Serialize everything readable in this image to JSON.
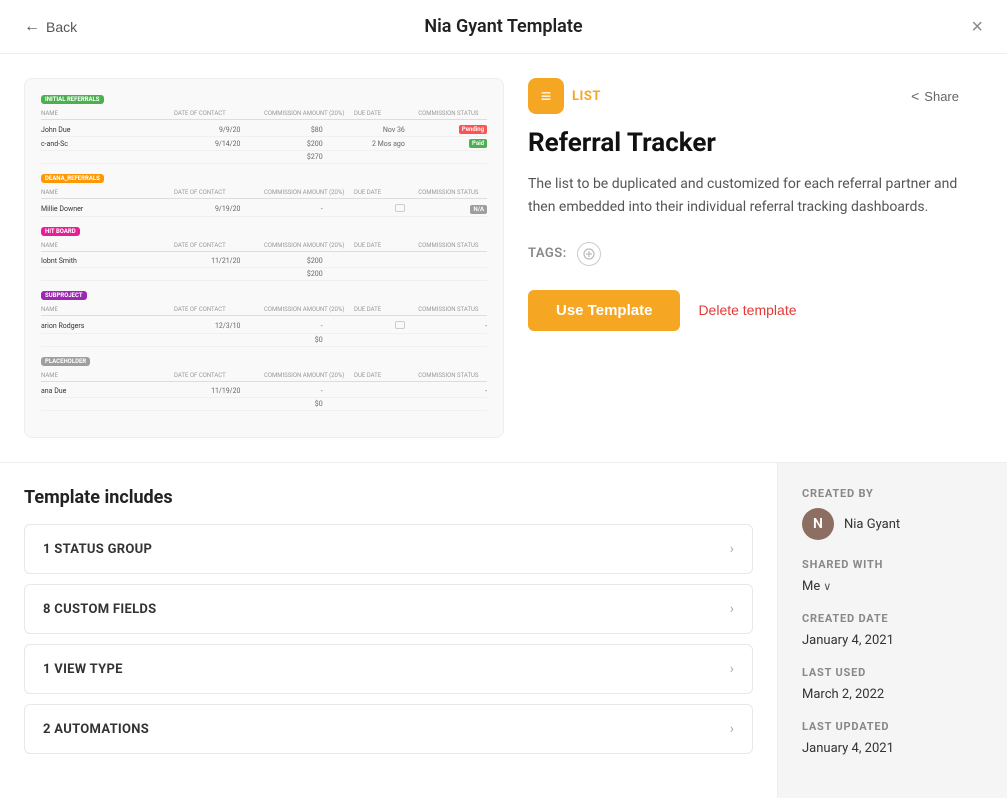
{
  "header": {
    "title": "Nia Gyant Template",
    "back_label": "Back",
    "close_label": "×"
  },
  "preview": {
    "sections": [
      {
        "badge_label": "INITIAL REFERRALS",
        "badge_color": "green",
        "rows": [
          {
            "name": "John Due",
            "date": "9/9/20",
            "commission": "$80",
            "due_date": "Nov 36",
            "status": "Pending",
            "status_color": "pending"
          },
          {
            "name": "c-and-Sc",
            "date": "9/14/20",
            "commission": "$200",
            "due_date": "2 More ago",
            "status": "Paid",
            "status_color": "paid"
          }
        ]
      },
      {
        "badge_label": "DEANA_REFERRALS",
        "badge_color": "orange",
        "rows": [
          {
            "name": "Millie Downer",
            "date": "9/19/20",
            "commission": "-",
            "due_date": "",
            "status": "N/A",
            "status_color": "na"
          }
        ]
      },
      {
        "badge_label": "HIT BOARD",
        "badge_color": "pink",
        "rows": [
          {
            "name": "Iobnt Smith",
            "date": "11/21/20",
            "commission": "$200",
            "due_date": "",
            "status": "",
            "status_color": ""
          },
          {
            "name": "",
            "date": "",
            "commission": "$200",
            "due_date": "",
            "status": "",
            "status_color": ""
          }
        ]
      },
      {
        "badge_label": "SUBPROJECT",
        "badge_color": "purple",
        "rows": [
          {
            "name": "arion Rodgers",
            "date": "12/3/10",
            "commission": "-",
            "due_date": "",
            "status": "",
            "status_color": ""
          },
          {
            "name": "",
            "date": "",
            "commission": "$0",
            "due_date": "",
            "status": "",
            "status_color": ""
          }
        ]
      },
      {
        "badge_label": "PLACEHOLDER",
        "badge_color": "gray",
        "rows": [
          {
            "name": "ana Due",
            "date": "11/19/20",
            "commission": "-",
            "due_date": "",
            "status": "",
            "status_color": ""
          },
          {
            "name": "",
            "date": "",
            "commission": "$0",
            "due_date": "",
            "status": "",
            "status_color": ""
          }
        ]
      }
    ]
  },
  "detail": {
    "type_label": "LIST",
    "share_label": "Share",
    "title": "Referral Tracker",
    "description": "The list to be duplicated and customized for each referral partner and then embedded into their individual referral tracking dashboards.",
    "tags_label": "TAGS:",
    "use_template_label": "Use Template",
    "delete_template_label": "Delete template"
  },
  "includes": {
    "title": "Template includes",
    "items": [
      {
        "label": "1 STATUS GROUP"
      },
      {
        "label": "8 CUSTOM FIELDS"
      },
      {
        "label": "1 VIEW TYPE"
      },
      {
        "label": "2 AUTOMATIONS"
      }
    ]
  },
  "sidebar": {
    "created_by_label": "CREATED BY",
    "creator_name": "Nia Gyant",
    "creator_initials": "N",
    "shared_with_label": "SHARED WITH",
    "shared_with_value": "Me",
    "created_date_label": "CREATED DATE",
    "created_date_value": "January 4, 2021",
    "last_used_label": "LAST USED",
    "last_used_value": "March 2, 2022",
    "last_updated_label": "LAST UPDATED",
    "last_updated_value": "January 4, 2021"
  }
}
